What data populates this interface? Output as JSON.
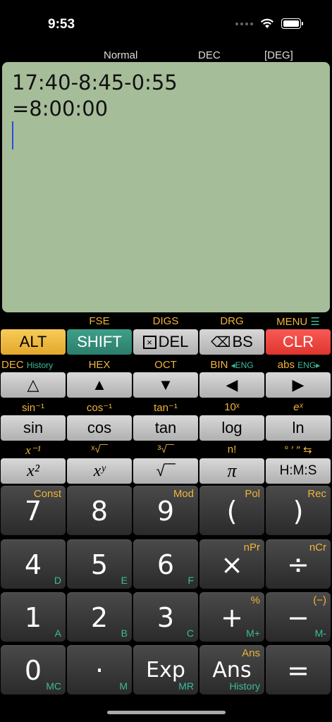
{
  "status": {
    "time": "9:53"
  },
  "modes": {
    "normal": "Normal",
    "base": "DEC",
    "angle": "[DEG]"
  },
  "display": {
    "expression": "17:40-8:45-0:55",
    "result": "=8:00:00"
  },
  "row1": {
    "labels": [
      "FSE",
      "DIGS",
      "DRG",
      "MENU"
    ],
    "buttons": [
      "ALT",
      "SHIFT",
      "DEL",
      "BS",
      "CLR"
    ]
  },
  "row2": {
    "labels": {
      "dec": "DEC",
      "history": "History",
      "hex": "HEX",
      "oct": "OCT",
      "bin": "BIN",
      "eng1": "◂ENG",
      "abs": "abs",
      "eng2": "ENG▸"
    }
  },
  "row3": {
    "labels": [
      "sin⁻¹",
      "cos⁻¹",
      "tan⁻¹",
      "10ˣ",
      "eˣ"
    ],
    "buttons": [
      "sin",
      "cos",
      "tan",
      "log",
      "ln"
    ]
  },
  "row4": {
    "labels": [
      "x⁻¹",
      "ˣ√‾‾",
      "³√‾‾",
      "n!",
      "° ′ ″ ⇆"
    ],
    "buttons": [
      "x²",
      "xʸ",
      "√‾‾",
      "π",
      "H:M:S"
    ]
  },
  "keys": [
    {
      "main": "7",
      "tr": "Const",
      "br": ""
    },
    {
      "main": "8",
      "tr": "",
      "br": ""
    },
    {
      "main": "9",
      "tr": "Mod",
      "br": ""
    },
    {
      "main": "(",
      "tr": "Pol",
      "br": ""
    },
    {
      "main": ")",
      "tr": "Rec",
      "br": ""
    },
    {
      "main": "4",
      "tr": "",
      "br": "D"
    },
    {
      "main": "5",
      "tr": "",
      "br": "E"
    },
    {
      "main": "6",
      "tr": "",
      "br": "F"
    },
    {
      "main": "×",
      "tr": "nPr",
      "br": ""
    },
    {
      "main": "÷",
      "tr": "nCr",
      "br": ""
    },
    {
      "main": "1",
      "tr": "",
      "br": "A"
    },
    {
      "main": "2",
      "tr": "",
      "br": "B"
    },
    {
      "main": "3",
      "tr": "",
      "br": "C"
    },
    {
      "main": "+",
      "tr": "%",
      "br": "M+"
    },
    {
      "main": "−",
      "tr": "(−)",
      "br": "M-"
    },
    {
      "main": "0",
      "tr": "",
      "br": "MC"
    },
    {
      "main": "·",
      "tr": "",
      "br": "M"
    },
    {
      "main": "Exp",
      "tr": "",
      "br": "MR"
    },
    {
      "main": "Ans",
      "tr": "Ans",
      "br": "History"
    },
    {
      "main": "=",
      "tr": "",
      "br": ""
    }
  ],
  "colors": {
    "display_bg": "#a6bd99",
    "alt": "#f0b43a",
    "shift": "#3f9f88",
    "clr": "#f04a45",
    "label_gold": "#f0b43a",
    "label_teal": "#3dbb9b"
  }
}
